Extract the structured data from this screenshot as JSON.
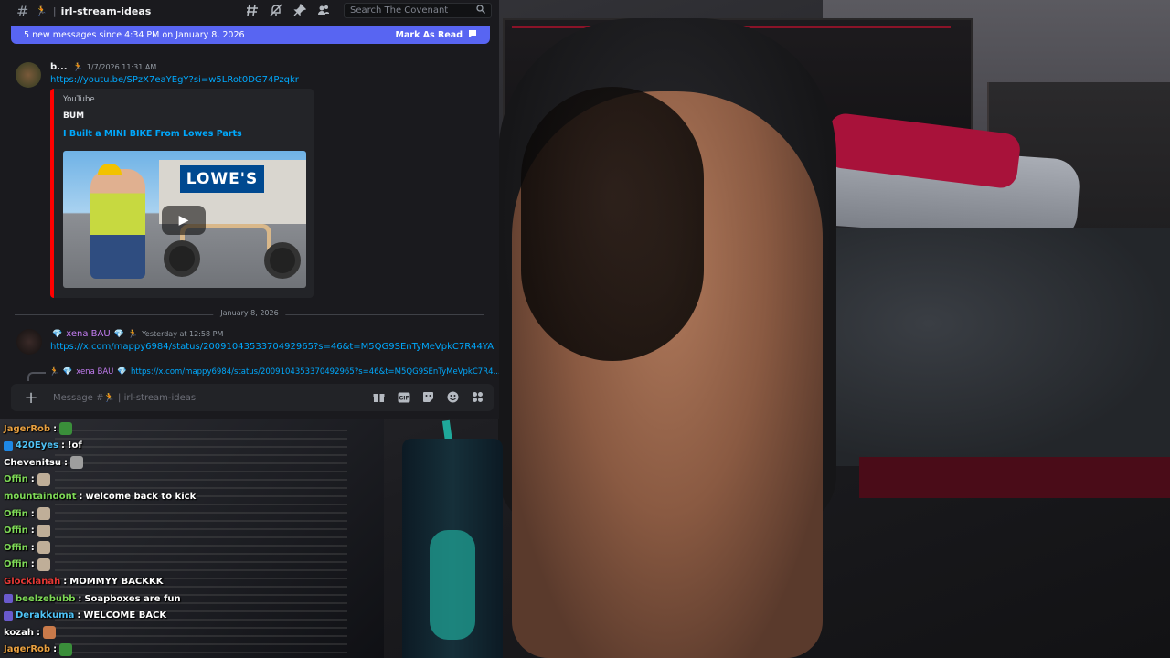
{
  "discord": {
    "channel_name": "irl-stream-ideas",
    "search_placeholder": "Search The Covenant",
    "toolbar_icons": [
      "threads-icon",
      "mute-bell-icon",
      "pin-icon",
      "members-icon"
    ],
    "banner": {
      "text": "5 new messages since 4:34 PM on January 8, 2026",
      "action": "Mark As Read"
    },
    "message1": {
      "username": "b...",
      "timestamp": "1/7/2026 11:31 AM",
      "link": "https://youtu.be/SPzX7eaYEgY?si=w5LRot0DG74Pzqkr",
      "embed": {
        "provider": "YouTube",
        "author": "BUM",
        "title": "I Built a MINI BIKE From Lowes Parts",
        "thumbnail_sign": "LOWE'S"
      }
    },
    "date_divider": "January 8, 2026",
    "message2": {
      "username": "xena BAU",
      "timestamp": "Yesterday at 12:58 PM",
      "link": "https://x.com/mappy6984/status/2009104353370492965?s=46&t=M5QG9SEnTyMeVpkC7R44YA"
    },
    "reply_preview": {
      "username": "xena BAU",
      "text": "https://x.com/mappy6984/status/2009104353370492965?s=46&t=M5QG9SEnTyMeVpkC7R4..."
    },
    "composer": {
      "placeholder": "Message #🏃 | irl-stream-ideas"
    },
    "colors": {
      "accent": "#5865f2",
      "link": "#00a8fc",
      "youtube_red": "#ff0000",
      "bg": "#1a1a1e"
    }
  },
  "chat": [
    {
      "user": "JagerRob",
      "color": "#e8a040",
      "text": "",
      "emote": "#3a8f3a"
    },
    {
      "user": "420Eyes",
      "color": "#4fc3f7",
      "text": "!of",
      "badge": "#1e88e5"
    },
    {
      "user": "Chevenitsu",
      "color": "#ffffff",
      "text": "",
      "emote": "#9e9e9e"
    },
    {
      "user": "Offin",
      "color": "#7ed957",
      "text": "",
      "emote": "#bfae98"
    },
    {
      "user": "mountaindont",
      "color": "#7ed957",
      "text": "welcome back to kick"
    },
    {
      "user": "Offin",
      "color": "#7ed957",
      "text": "",
      "emote": "#bfae98"
    },
    {
      "user": "Offin",
      "color": "#7ed957",
      "text": "",
      "emote": "#bfae98"
    },
    {
      "user": "Offin",
      "color": "#7ed957",
      "text": "",
      "emote": "#bfae98"
    },
    {
      "user": "Offin",
      "color": "#7ed957",
      "text": "",
      "emote": "#bfae98"
    },
    {
      "user": "Glocklanah",
      "color": "#e53935",
      "text": "MOMMYY BACKKK"
    },
    {
      "user": "beelzebubb",
      "color": "#7ed957",
      "text": "Soapboxes are fun",
      "badge": "#6a5acd"
    },
    {
      "user": "Derakkuma",
      "color": "#4fc3f7",
      "text": "WELCOME BACK",
      "badge": "#6a5acd"
    },
    {
      "user": "kozah",
      "color": "#ffffff",
      "text": "",
      "emote": "#c97a4a"
    },
    {
      "user": "JagerRob",
      "color": "#e8a040",
      "text": "",
      "emote": "#3a8f3a"
    }
  ]
}
